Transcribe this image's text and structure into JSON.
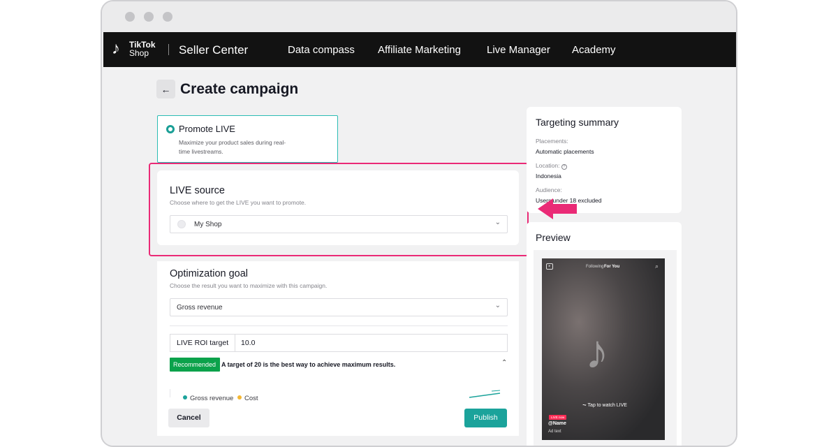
{
  "window": {
    "dots": [
      "close",
      "minimize",
      "maximize"
    ]
  },
  "nav": {
    "logo_line1": "TikTok",
    "logo_line2": "Shop",
    "brand": "Seller Center",
    "items": [
      "Data compass",
      "Affiliate Marketing",
      "Live Manager",
      "Academy"
    ]
  },
  "page": {
    "title": "Create campaign",
    "back_icon": "arrow-left-icon"
  },
  "promote": {
    "title": "Promote LIVE",
    "description": "Maximize your product sales during real-time livestreams."
  },
  "live_source": {
    "title": "LIVE source",
    "subtitle": "Choose where to get the LIVE you want to promote.",
    "selected": "My Shop"
  },
  "optimization": {
    "title": "Optimization goal",
    "subtitle": "Choose the result you want to maximize with this campaign.",
    "selected": "Gross revenue",
    "roi_label": "LIVE ROI target",
    "roi_value": "10.0",
    "recommended_badge": "Recommended",
    "recommended_text": "A target of 20 is the best way to achieve maximum results.",
    "legend": [
      {
        "label": "Gross revenue",
        "color": "#1ba39b"
      },
      {
        "label": "Cost",
        "color": "#f5b731"
      }
    ]
  },
  "actions": {
    "cancel": "Cancel",
    "publish": "Publish"
  },
  "summary": {
    "title": "Targeting summary",
    "placements_label": "Placements:",
    "placements_value": "Automatic placements",
    "location_label": "Location:",
    "location_value": "Indonesia",
    "audience_label": "Audience:",
    "audience_value": "Users under 18 excluded"
  },
  "preview": {
    "title": "Preview",
    "tab_following": "Following",
    "tab_for_you": "For You",
    "tap_text": "Tap to watch LIVE",
    "live_badge": "LIVE now",
    "name": "@Name",
    "ad_text": "Ad text"
  },
  "colors": {
    "accent": "#1ba39b",
    "highlight": "#ea2a76",
    "recommended": "#0ba24b",
    "nav_bg": "#121212"
  }
}
